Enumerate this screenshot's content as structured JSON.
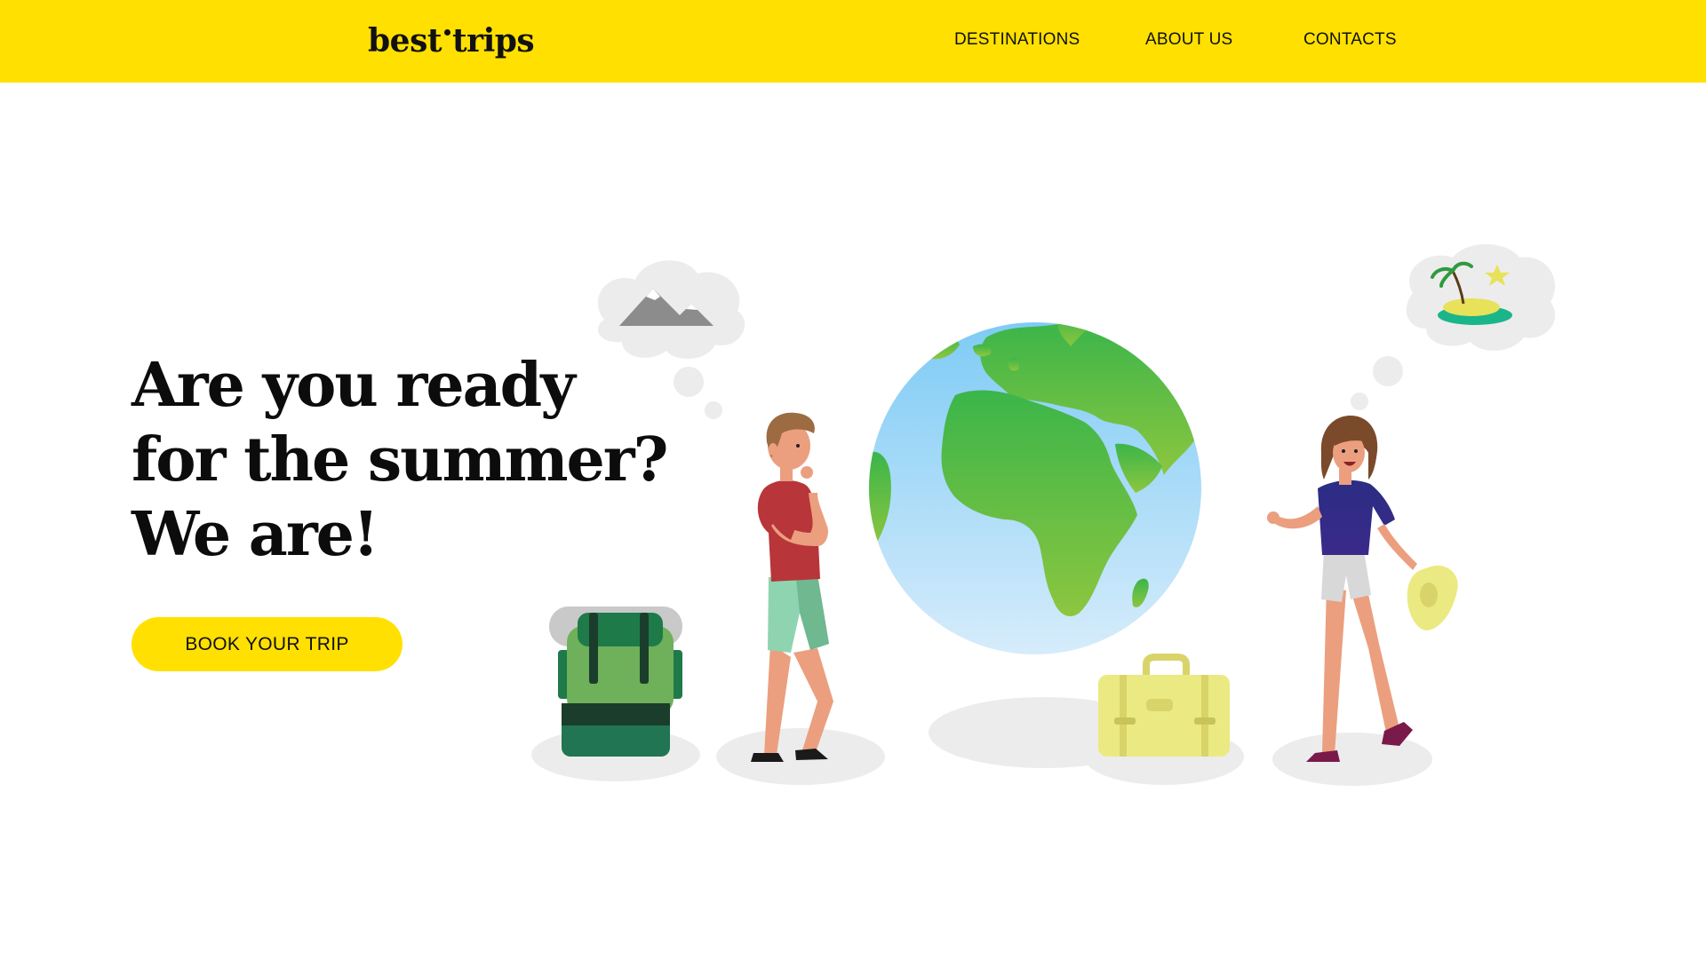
{
  "header": {
    "logo_word1": "best",
    "logo_word2": "trips",
    "nav": [
      "DESTINATIONS",
      "ABOUT US",
      "CONTACTS"
    ],
    "background_color": "#ffe000"
  },
  "hero": {
    "headline_lines": [
      "Are you ready",
      "for the summer?",
      "We are!"
    ],
    "cta_label": "BOOK YOUR TRIP",
    "cta_color": "#ffe000"
  },
  "illustration": {
    "elements": [
      "globe-icon",
      "backpack-icon",
      "suitcase-icon",
      "mountain-icon",
      "island-icon",
      "hat-icon",
      "traveler-man",
      "traveler-woman"
    ]
  }
}
